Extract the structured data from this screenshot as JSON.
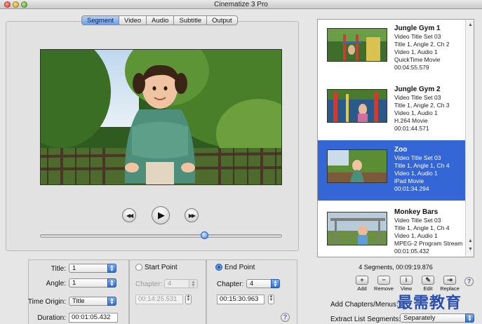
{
  "window": {
    "title": "Cinematize 3 Pro"
  },
  "tabs": [
    {
      "label": "Segment",
      "active": true
    },
    {
      "label": "Video",
      "active": false
    },
    {
      "label": "Audio",
      "active": false
    },
    {
      "label": "Subtitle",
      "active": false
    },
    {
      "label": "Output",
      "active": false
    }
  ],
  "playback": {
    "progress": 0.68
  },
  "segment_fields": {
    "title_label": "Title:",
    "title_value": "1",
    "angle_label": "Angle:",
    "angle_value": "1",
    "time_origin_label": "Time Origin:",
    "time_origin_value": "Title",
    "duration_label": "Duration:",
    "duration_value": "00:01:05.432"
  },
  "start_point": {
    "label": "Start Point",
    "chapter_label": "Chapter:",
    "chapter_value": "4",
    "time_value": "00:14:25.531"
  },
  "end_point": {
    "label": "End Point",
    "chapter_label": "Chapter:",
    "chapter_value": "4",
    "time_value": "00:15:30.963"
  },
  "segments": [
    {
      "name": "Jungle Gym 1",
      "lines": [
        "Video Title Set 03",
        "Title 1, Angle 2, Ch 2",
        "Video 1, Audio 1",
        "QuickTime Movie",
        "00:04:55.579"
      ],
      "selected": false
    },
    {
      "name": "Jungle Gym 2",
      "lines": [
        "Video Title Set 03",
        "Title 1, Angle 2, Ch 3",
        "Video 1, Audio 1",
        "H.264 Movie",
        "00:01:44.571"
      ],
      "selected": false
    },
    {
      "name": "Zoo",
      "lines": [
        "Video Title Set 03",
        "Title 1, Angle 1, Ch 4",
        "Video 1, Audio 1",
        "iPad Movie",
        "00:01:34.294"
      ],
      "selected": true
    },
    {
      "name": "Monkey Bars",
      "lines": [
        "Video Title Set 03",
        "Title 1, Angle 1, Ch 4",
        "Video 1, Audio 1",
        "MPEG-2 Program Stream",
        "00:01:05.432"
      ],
      "selected": false
    }
  ],
  "summary": "4 Segments, 00:09:19.876",
  "actions": [
    {
      "label": "Add",
      "icon": "plus-icon",
      "glyph": "+"
    },
    {
      "label": "Remove",
      "icon": "minus-icon",
      "glyph": "−"
    },
    {
      "label": "View",
      "icon": "info-icon",
      "glyph": "i"
    },
    {
      "label": "Edit",
      "icon": "edit-icon",
      "glyph": "✎"
    },
    {
      "label": "Replace",
      "icon": "replace-icon",
      "glyph": "⇥"
    }
  ],
  "bottom_right": {
    "add_chapters_label": "Add Chapters/Menus:",
    "extract_label": "Extract List Segments:",
    "extract_value": "Separately"
  },
  "watermark": "最需教育",
  "colors": {
    "selection": "#3566d6",
    "accent": "#3a78d6"
  }
}
